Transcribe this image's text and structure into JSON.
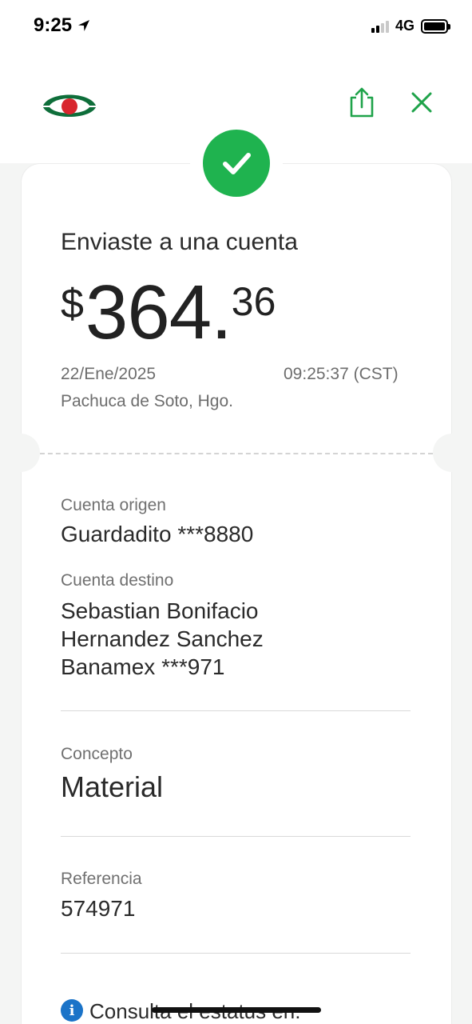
{
  "status_bar": {
    "time": "9:25",
    "network": "4G",
    "icons": [
      "location-arrow-icon",
      "cellular-signal-icon",
      "battery-icon"
    ]
  },
  "header": {
    "logo": "bank-logo",
    "actions": [
      "share-icon",
      "close-icon"
    ],
    "colors": {
      "accent_green": "#1fb34f",
      "logo_red": "#d8262e",
      "logo_green": "#0e6e3a"
    }
  },
  "receipt": {
    "title": "Enviaste a una cuenta",
    "amount": {
      "currency": "$",
      "integer": "364.",
      "decimals": "36"
    },
    "date": "22/Ene/2025",
    "time": "09:25:37 (CST)",
    "location": "Pachuca de Soto, Hgo."
  },
  "details": {
    "origin": {
      "label": "Cuenta origen",
      "value": "Guardadito ***8880"
    },
    "destination": {
      "label": "Cuenta destino",
      "name_line1": "Sebastian Bonifacio",
      "name_line2": "Hernandez Sanchez",
      "bank": "Banamex ***971"
    },
    "concept": {
      "label": "Concepto",
      "value": "Material"
    },
    "reference": {
      "label": "Referencia",
      "value": "574971"
    },
    "status_link": {
      "icon": "info-icon",
      "text": "Consulta el estatus en:"
    }
  }
}
